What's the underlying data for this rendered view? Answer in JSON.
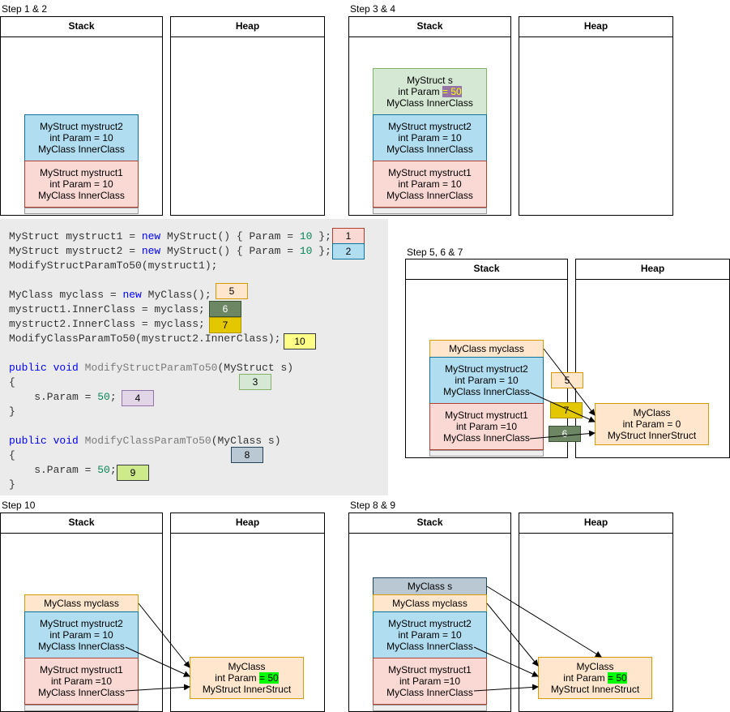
{
  "labels": {
    "step12": "Step 1 & 2",
    "step34": "Step 3 & 4",
    "step567": "Step 5, 6 & 7",
    "step10": "Step 10",
    "step89": "Step 8 & 9",
    "stack": "Stack",
    "heap": "Heap"
  },
  "boxes": {
    "mystruct2": [
      "MyStruct mystruct2",
      "int Param = 10",
      "MyClass InnerClass"
    ],
    "mystruct1": [
      "MyStruct mystruct1",
      "int Param = 10",
      "MyClass InnerClass"
    ],
    "mystruct1_b": [
      "MyStruct mystruct1",
      "int Param =10",
      "MyClass InnerClass"
    ],
    "struct_s_line1": "MyStruct s",
    "struct_s_line2_pre": "int Param ",
    "struct_s_line2_hl": "= 50",
    "struct_s_line3": "MyClass InnerClass",
    "myclass_var": "MyClass myclass",
    "myclass_s": "MyClass s",
    "heap_obj_a": [
      "MyClass",
      "int Param = 0",
      "MyStruct InnerStruct"
    ],
    "heap_obj_b_line1": "MyClass",
    "heap_obj_b_pre": "int Param ",
    "heap_obj_b_hl": "= 50",
    "heap_obj_b_line3": "MyStruct InnerStruct"
  },
  "code": {
    "l1a": "MyStruct mystruct1 = ",
    "l1kw": "new",
    "l1b": " MyStruct() { Param = ",
    "l1n": "10",
    "l1c": " };",
    "l2a": "MyStruct mystruct2 = ",
    "l2kw": "new",
    "l2b": " MyStruct() { Param = ",
    "l2n": "10",
    "l2c": " };",
    "l3": "ModifyStructParamTo50(mystruct1);",
    "l4a": "MyClass myclass = ",
    "l4kw": "new",
    "l4b": " MyClass();",
    "l5": "mystruct1.InnerClass = myclass;",
    "l6": "mystruct2.InnerClass = myclass;",
    "l7": "ModifyClassParamTo50(mystruct2.InnerClass);",
    "l8kw1": "public",
    "l8kw2": "void",
    "l8fn": "ModifyStructParamTo50",
    "l8b": "(MyStruct s)",
    "l9": "{",
    "l10a": "    s.Param = ",
    "l10n": "50",
    "l10b": ";",
    "l11": "}",
    "l12kw1": "public",
    "l12kw2": "void",
    "l12fn": "ModifyClassParamTo50",
    "l12b": "(MyClass s)",
    "l13": "{",
    "l14a": "    s.Param = ",
    "l14n": "50",
    "l14b": ";",
    "l15": "}"
  },
  "tags": {
    "t1": "1",
    "t2": "2",
    "t3": "3",
    "t4": "4",
    "t5": "5",
    "t6": "6",
    "t7": "7",
    "t8": "8",
    "t9": "9",
    "t10": "10"
  }
}
